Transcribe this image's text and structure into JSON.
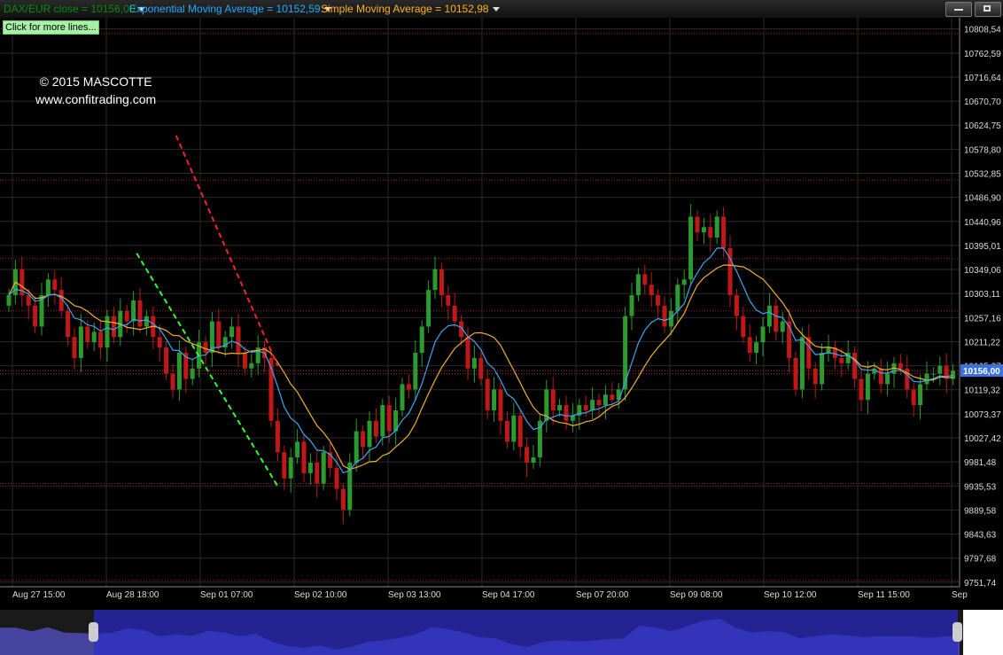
{
  "legend": {
    "main": "DAX/EUR close = 10156,00",
    "ema": "Exponential Moving Average = 10152,59",
    "sma": "Simple Moving Average = 10152,98"
  },
  "more_lines_button": "Click for more lines...",
  "watermark": {
    "line1": "© 2015 MASCOTTE",
    "line2": "www.confitrading.com"
  },
  "colors": {
    "up": "#2d9a2d",
    "down": "#c01818",
    "ema": "#3aa8f0",
    "sma": "#f0b030",
    "resistance": "#ff2020",
    "support": "#30ff30",
    "level": "#a02020",
    "grid": "#2a2a2a",
    "price_tag": "#3a70e0",
    "navigator": "#2626a8"
  },
  "chart_data": {
    "type": "candlestick",
    "ylim": [
      9743,
      10830
    ],
    "y_ticks": [
      "10808,54",
      "10762,59",
      "10716,64",
      "10670,70",
      "10624,75",
      "10578,80",
      "10532,85",
      "10486,90",
      "10440,96",
      "10395,01",
      "10349,06",
      "10303,11",
      "10257,16",
      "10211,22",
      "10165,27",
      "10119,32",
      "10073,37",
      "10027,42",
      "9981,48",
      "9935,53",
      "9889,58",
      "9843,63",
      "9797,68",
      "9751,74"
    ],
    "x_labels": [
      "Aug 27 15:00",
      "Aug 28 18:00",
      "Sep 01 07:00",
      "Sep 02 10:00",
      "Sep 03 13:00",
      "Sep 04 17:00",
      "Sep 07 20:00",
      "Sep 09 08:00",
      "Sep 10 12:00",
      "Sep 11 15:00",
      "Sep"
    ],
    "last_price": "10156,00",
    "last_value": 10156,
    "horizontal_levels": [
      10800,
      10520,
      10370,
      10270,
      10150,
      9940,
      9755
    ],
    "resistance_trendline": {
      "from": [
        25.5,
        10605
      ],
      "to": [
        41.0,
        10165
      ]
    },
    "support_trendline": {
      "from": [
        19.5,
        10380
      ],
      "to": [
        41.0,
        9935
      ]
    },
    "closes": [
      10300,
      10350,
      10300,
      10280,
      10240,
      10300,
      10330,
      10310,
      10270,
      10220,
      10180,
      10240,
      10210,
      10230,
      10200,
      10260,
      10220,
      10270,
      10250,
      10290,
      10240,
      10260,
      10220,
      10200,
      10150,
      10120,
      10190,
      10140,
      10160,
      10210,
      10190,
      10250,
      10200,
      10220,
      10240,
      10190,
      10160,
      10170,
      10200,
      10180,
      10060,
      10000,
      9950,
      9990,
      10020,
      9960,
      9980,
      9940,
      10000,
      9970,
      9930,
      9890,
      9980,
      10040,
      10010,
      10060,
      10030,
      10090,
      10040,
      10080,
      10130,
      10120,
      10190,
      10240,
      10310,
      10350,
      10300,
      10280,
      10250,
      10220,
      10160,
      10180,
      10140,
      10080,
      10120,
      10060,
      10020,
      10070,
      10010,
      9980,
      9990,
      10060,
      10120,
      10080,
      10090,
      10060,
      10070,
      10090,
      10080,
      10100,
      10090,
      10110,
      10100,
      10120,
      10260,
      10300,
      10340,
      10320,
      10300,
      10280,
      10240,
      10270,
      10320,
      10330,
      10450,
      10420,
      10430,
      10410,
      10450,
      10390,
      10300,
      10260,
      10220,
      10190,
      10210,
      10240,
      10280,
      10230,
      10250,
      10180,
      10120,
      10220,
      10160,
      10130,
      10190,
      10200,
      10180,
      10170,
      10190,
      10140,
      10100,
      10150,
      10160,
      10130,
      10150,
      10170,
      10160,
      10120,
      10090,
      10130,
      10150,
      10150,
      10165,
      10140,
      10156
    ]
  }
}
